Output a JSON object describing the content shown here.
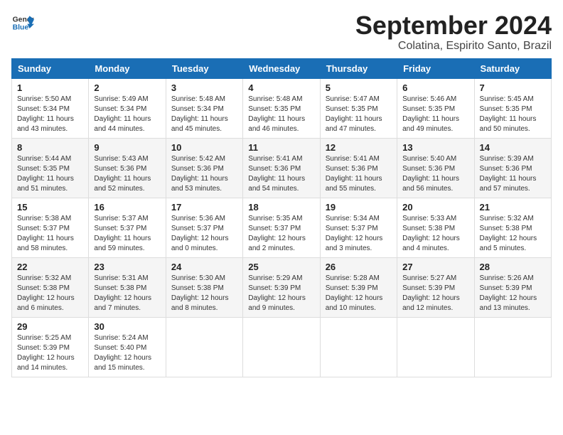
{
  "logo": {
    "text_general": "General",
    "text_blue": "Blue"
  },
  "title": {
    "month_year": "September 2024",
    "location": "Colatina, Espirito Santo, Brazil"
  },
  "weekdays": [
    "Sunday",
    "Monday",
    "Tuesday",
    "Wednesday",
    "Thursday",
    "Friday",
    "Saturday"
  ],
  "weeks": [
    [
      {
        "day": "1",
        "sunrise": "5:50 AM",
        "sunset": "5:34 PM",
        "daylight": "11 hours and 43 minutes."
      },
      {
        "day": "2",
        "sunrise": "5:49 AM",
        "sunset": "5:34 PM",
        "daylight": "11 hours and 44 minutes."
      },
      {
        "day": "3",
        "sunrise": "5:48 AM",
        "sunset": "5:34 PM",
        "daylight": "11 hours and 45 minutes."
      },
      {
        "day": "4",
        "sunrise": "5:48 AM",
        "sunset": "5:35 PM",
        "daylight": "11 hours and 46 minutes."
      },
      {
        "day": "5",
        "sunrise": "5:47 AM",
        "sunset": "5:35 PM",
        "daylight": "11 hours and 47 minutes."
      },
      {
        "day": "6",
        "sunrise": "5:46 AM",
        "sunset": "5:35 PM",
        "daylight": "11 hours and 49 minutes."
      },
      {
        "day": "7",
        "sunrise": "5:45 AM",
        "sunset": "5:35 PM",
        "daylight": "11 hours and 50 minutes."
      }
    ],
    [
      {
        "day": "8",
        "sunrise": "5:44 AM",
        "sunset": "5:35 PM",
        "daylight": "11 hours and 51 minutes."
      },
      {
        "day": "9",
        "sunrise": "5:43 AM",
        "sunset": "5:36 PM",
        "daylight": "11 hours and 52 minutes."
      },
      {
        "day": "10",
        "sunrise": "5:42 AM",
        "sunset": "5:36 PM",
        "daylight": "11 hours and 53 minutes."
      },
      {
        "day": "11",
        "sunrise": "5:41 AM",
        "sunset": "5:36 PM",
        "daylight": "11 hours and 54 minutes."
      },
      {
        "day": "12",
        "sunrise": "5:41 AM",
        "sunset": "5:36 PM",
        "daylight": "11 hours and 55 minutes."
      },
      {
        "day": "13",
        "sunrise": "5:40 AM",
        "sunset": "5:36 PM",
        "daylight": "11 hours and 56 minutes."
      },
      {
        "day": "14",
        "sunrise": "5:39 AM",
        "sunset": "5:36 PM",
        "daylight": "11 hours and 57 minutes."
      }
    ],
    [
      {
        "day": "15",
        "sunrise": "5:38 AM",
        "sunset": "5:37 PM",
        "daylight": "11 hours and 58 minutes."
      },
      {
        "day": "16",
        "sunrise": "5:37 AM",
        "sunset": "5:37 PM",
        "daylight": "11 hours and 59 minutes."
      },
      {
        "day": "17",
        "sunrise": "5:36 AM",
        "sunset": "5:37 PM",
        "daylight": "12 hours and 0 minutes."
      },
      {
        "day": "18",
        "sunrise": "5:35 AM",
        "sunset": "5:37 PM",
        "daylight": "12 hours and 2 minutes."
      },
      {
        "day": "19",
        "sunrise": "5:34 AM",
        "sunset": "5:37 PM",
        "daylight": "12 hours and 3 minutes."
      },
      {
        "day": "20",
        "sunrise": "5:33 AM",
        "sunset": "5:38 PM",
        "daylight": "12 hours and 4 minutes."
      },
      {
        "day": "21",
        "sunrise": "5:32 AM",
        "sunset": "5:38 PM",
        "daylight": "12 hours and 5 minutes."
      }
    ],
    [
      {
        "day": "22",
        "sunrise": "5:32 AM",
        "sunset": "5:38 PM",
        "daylight": "12 hours and 6 minutes."
      },
      {
        "day": "23",
        "sunrise": "5:31 AM",
        "sunset": "5:38 PM",
        "daylight": "12 hours and 7 minutes."
      },
      {
        "day": "24",
        "sunrise": "5:30 AM",
        "sunset": "5:38 PM",
        "daylight": "12 hours and 8 minutes."
      },
      {
        "day": "25",
        "sunrise": "5:29 AM",
        "sunset": "5:39 PM",
        "daylight": "12 hours and 9 minutes."
      },
      {
        "day": "26",
        "sunrise": "5:28 AM",
        "sunset": "5:39 PM",
        "daylight": "12 hours and 10 minutes."
      },
      {
        "day": "27",
        "sunrise": "5:27 AM",
        "sunset": "5:39 PM",
        "daylight": "12 hours and 12 minutes."
      },
      {
        "day": "28",
        "sunrise": "5:26 AM",
        "sunset": "5:39 PM",
        "daylight": "12 hours and 13 minutes."
      }
    ],
    [
      {
        "day": "29",
        "sunrise": "5:25 AM",
        "sunset": "5:39 PM",
        "daylight": "12 hours and 14 minutes."
      },
      {
        "day": "30",
        "sunrise": "5:24 AM",
        "sunset": "5:40 PM",
        "daylight": "12 hours and 15 minutes."
      },
      null,
      null,
      null,
      null,
      null
    ]
  ]
}
